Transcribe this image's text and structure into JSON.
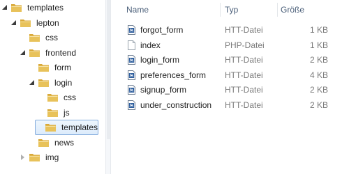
{
  "tree": [
    {
      "label": "templates",
      "indent": 0,
      "state": "open"
    },
    {
      "label": "lepton",
      "indent": 1,
      "state": "open"
    },
    {
      "label": "css",
      "indent": 2,
      "state": "none"
    },
    {
      "label": "frontend",
      "indent": 2,
      "state": "open"
    },
    {
      "label": "form",
      "indent": 3,
      "state": "none"
    },
    {
      "label": "login",
      "indent": 3,
      "state": "open"
    },
    {
      "label": "css",
      "indent": 4,
      "state": "none"
    },
    {
      "label": "js",
      "indent": 4,
      "state": "none"
    },
    {
      "label": "templates",
      "indent": 4,
      "state": "none",
      "selected": true
    },
    {
      "label": "news",
      "indent": 3,
      "state": "none"
    },
    {
      "label": "img",
      "indent": 2,
      "state": "closed"
    }
  ],
  "columns": {
    "name": "Name",
    "type": "Typ",
    "size": "Größe"
  },
  "files": [
    {
      "name": "forgot_form",
      "type": "HTT-Datei",
      "size": "1 KB",
      "icon": "htt-file-icon"
    },
    {
      "name": "index",
      "type": "PHP-Datei",
      "size": "1 KB",
      "icon": "php-file-icon"
    },
    {
      "name": "login_form",
      "type": "HTT-Datei",
      "size": "2 KB",
      "icon": "htt-file-icon"
    },
    {
      "name": "preferences_form",
      "type": "HTT-Datei",
      "size": "4 KB",
      "icon": "htt-file-icon"
    },
    {
      "name": "signup_form",
      "type": "HTT-Datei",
      "size": "2 KB",
      "icon": "htt-file-icon"
    },
    {
      "name": "under_construction",
      "type": "HTT-Datei",
      "size": "2 KB",
      "icon": "htt-file-icon"
    }
  ],
  "colors": {
    "folder": "#e8c25a",
    "selection_border": "#84acdd",
    "header_text": "#4c607a"
  }
}
